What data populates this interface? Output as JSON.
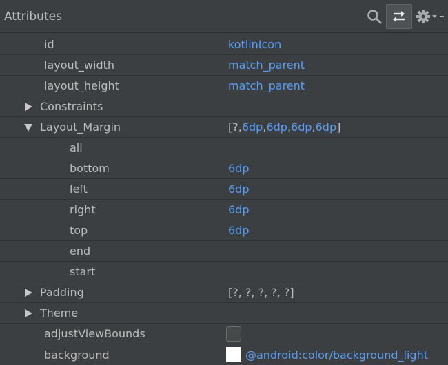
{
  "header": {
    "title": "Attributes",
    "icons": [
      "search-icon",
      "swap-icon",
      "gear-icon",
      "more-icon"
    ]
  },
  "rows": {
    "id": {
      "name": "id",
      "value": "kotlinIcon"
    },
    "layout_width": {
      "name": "layout_width",
      "value": "match_parent"
    },
    "layout_height": {
      "name": "layout_height",
      "value": "match_parent"
    },
    "constraints": {
      "name": "Constraints",
      "expanded": false
    },
    "layout_margin": {
      "name": "Layout_Margin",
      "expanded": true,
      "summary": {
        "open": "[",
        "first": "?",
        "sep": ", ",
        "v1": "6dp",
        "v2": "6dp",
        "v3": "6dp",
        "v4": "6dp",
        "close": "]"
      }
    },
    "all": {
      "name": "all",
      "value": ""
    },
    "bottom": {
      "name": "bottom",
      "value": "6dp"
    },
    "left": {
      "name": "left",
      "value": "6dp"
    },
    "right": {
      "name": "right",
      "value": "6dp"
    },
    "top": {
      "name": "top",
      "value": "6dp"
    },
    "end": {
      "name": "end",
      "value": ""
    },
    "start": {
      "name": "start",
      "value": ""
    },
    "padding": {
      "name": "Padding",
      "expanded": false,
      "value": "[?, ?, ?, ?, ?]"
    },
    "theme": {
      "name": "Theme",
      "expanded": false
    },
    "adjustViewBounds": {
      "name": "adjustViewBounds",
      "checked": false
    },
    "background": {
      "name": "background",
      "value": "@android:color/background_light",
      "swatch_color": "#ffffff"
    }
  },
  "colors": {
    "panel_bg": "#3c3f41",
    "text": "#bbbbbb",
    "link": "#589df6"
  }
}
